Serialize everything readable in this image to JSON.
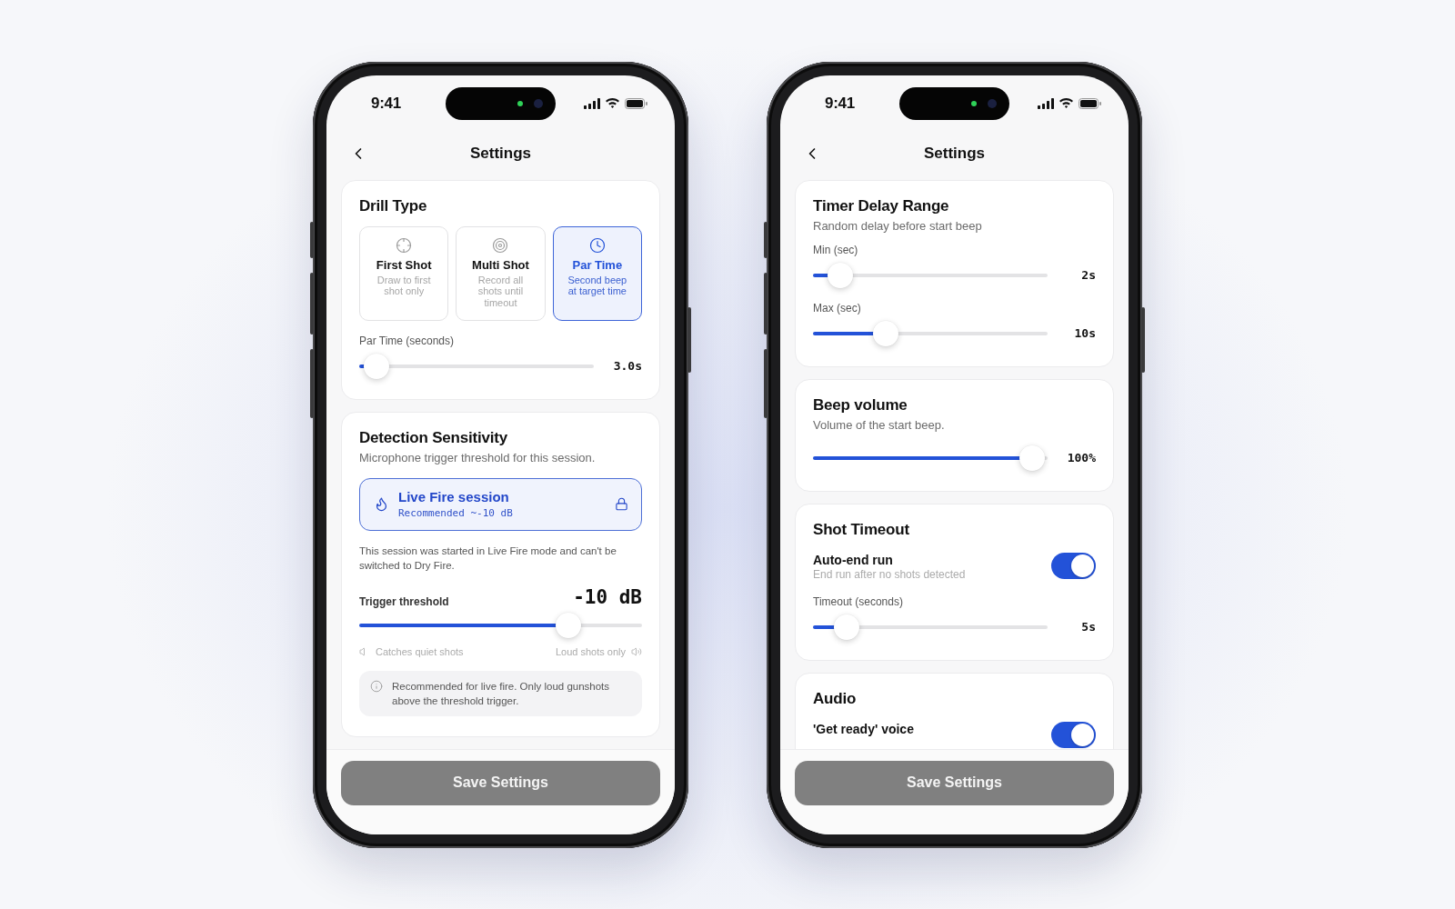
{
  "phones": [
    {
      "status_bar": {
        "time": "9:41"
      },
      "nav": {
        "title": "Settings"
      },
      "sections": [
        {
          "title": "Drill Type",
          "items": [
            {
              "kind": "options",
              "options": [
                {
                  "title": "First Shot",
                  "description": "Draw to first shot only",
                  "selected": false
                },
                {
                  "title": "Multi Shot",
                  "description": "Record all shots until timeout",
                  "selected": false
                },
                {
                  "title": "Par Time",
                  "description": "Second beep at target time",
                  "selected": true
                }
              ]
            },
            {
              "kind": "slider",
              "label": "Par Time (seconds)",
              "level": 0.01,
              "reading": "3.0s"
            }
          ]
        },
        {
          "title": "Detection Sensitivity",
          "subtitle": "Microphone trigger threshold for this session.",
          "items": [
            {
              "kind": "banner",
              "title": "Live Fire session",
              "detail": "Recommended ~-10 dB",
              "locked": true
            },
            {
              "kind": "note",
              "text": "This session was started in Live Fire mode and can't be switched to Dry Fire."
            },
            {
              "kind": "threshold",
              "label": "Trigger threshold",
              "reading": "-10 dB",
              "level": 0.77,
              "low_label": "Catches quiet shots",
              "high_label": "Loud shots only"
            },
            {
              "kind": "info",
              "text": "Recommended for live fire. Only loud gunshots above the threshold trigger."
            }
          ]
        }
      ],
      "footer_button": {
        "label": "Save Settings",
        "disabled": true
      }
    },
    {
      "status_bar": {
        "time": "9:41"
      },
      "nav": {
        "title": "Settings"
      },
      "sections": [
        {
          "title": "Timer Delay Range",
          "subtitle": "Random delay before start beep",
          "items": [
            {
              "kind": "slider",
              "label": "Min (sec)",
              "level": 0.06,
              "reading": "2s"
            },
            {
              "kind": "slider",
              "label": "Max (sec)",
              "level": 0.28,
              "reading": "10s"
            }
          ]
        },
        {
          "title": "Beep volume",
          "subtitle": "Volume of the start beep.",
          "items": [
            {
              "kind": "slider",
              "level": 1,
              "reading": "100%"
            }
          ]
        },
        {
          "title": "Shot Timeout",
          "items": [
            {
              "kind": "toggle",
              "label": "Auto-end run",
              "description": "End run after no shots detected",
              "on": true
            },
            {
              "kind": "slider",
              "label": "Timeout (seconds)",
              "level": 0.09,
              "reading": "5s"
            }
          ]
        },
        {
          "title": "Audio",
          "items": [
            {
              "kind": "toggle",
              "label": "'Get ready' voice",
              "on": true
            }
          ]
        }
      ],
      "footer_button": {
        "label": "Save Settings",
        "disabled": true
      }
    }
  ]
}
